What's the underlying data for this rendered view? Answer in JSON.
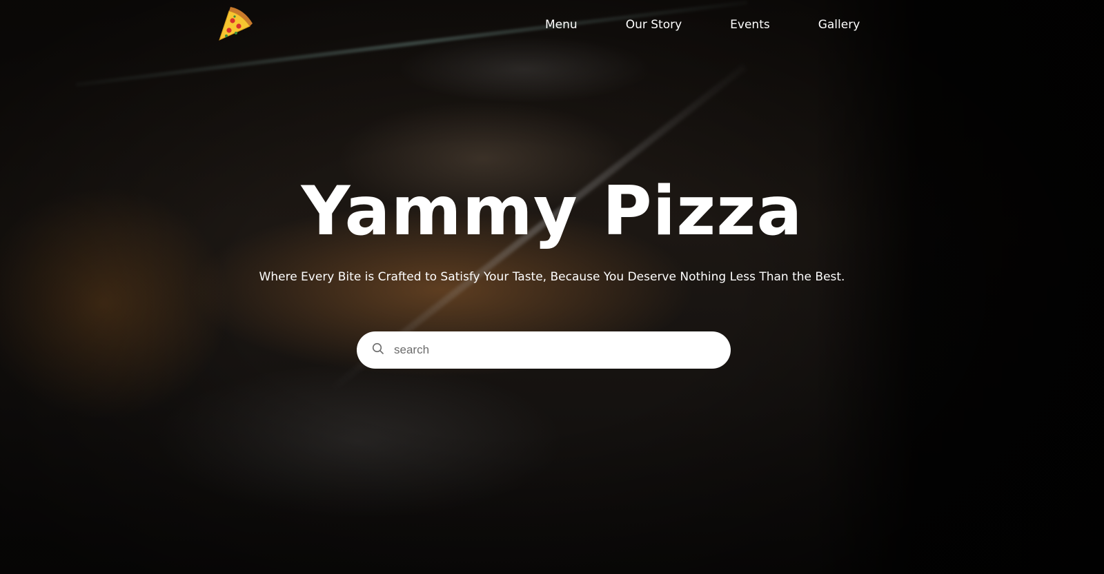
{
  "brand": {
    "logo_icon": "pizza-slice-icon"
  },
  "nav": {
    "items": [
      {
        "label": "Menu"
      },
      {
        "label": "Our Story"
      },
      {
        "label": "Events"
      },
      {
        "label": "Gallery"
      }
    ]
  },
  "hero": {
    "title": "Yammy Pizza",
    "subtitle": "Where Every Bite is Crafted to Satisfy Your Taste, Because You Deserve Nothing Less Than the Best."
  },
  "search": {
    "placeholder": "search",
    "value": "",
    "icon": "search-icon"
  },
  "colors": {
    "text": "#ffffff",
    "search_bg": "#ffffff"
  }
}
